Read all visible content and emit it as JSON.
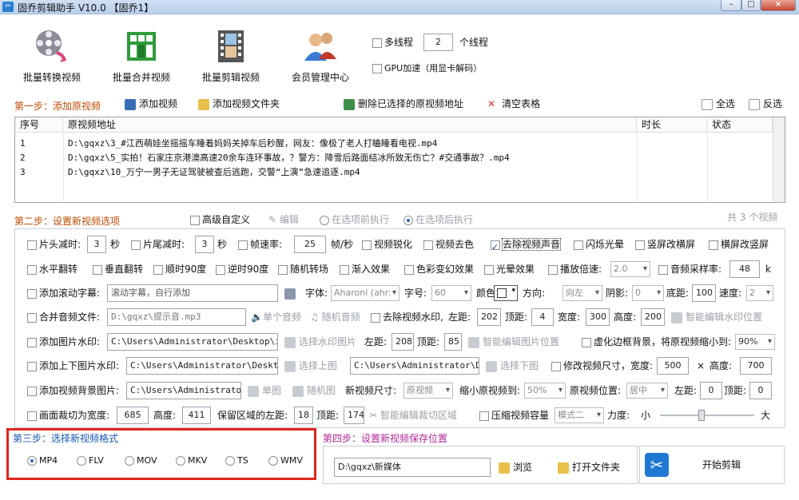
{
  "window": {
    "title": "固乔剪辑助手 V10.0 【固乔1】",
    "icon": "scissors-app-icon",
    "min": "–",
    "max": "□",
    "close": "×"
  },
  "toolbar": [
    {
      "label": "批量转换视频",
      "icon": "film-reel-icon"
    },
    {
      "label": "批量合并视频",
      "icon": "merge-blocks-icon"
    },
    {
      "label": "批量剪辑视频",
      "icon": "film-strip-icon"
    },
    {
      "label": "会员管理中心",
      "icon": "users-icon"
    }
  ],
  "multithread": {
    "label": "多线程",
    "value": "2",
    "unit": "个线程"
  },
  "gpu": {
    "label": "GPU加速（用显卡解码）"
  },
  "step1": {
    "title": "第一步：添加原视频",
    "add_video": "添加视频",
    "add_folder": "添加视频文件夹",
    "delete_selected": "删除已选择的原视频地址",
    "clear_table": "清空表格",
    "select_all": "全选",
    "invert": "反选"
  },
  "table": {
    "columns": [
      "序号",
      "原视频地址",
      "时长",
      "状态"
    ],
    "rows": [
      {
        "num": "1",
        "path": "D:\\gqxz\\3_#江西萌娃坐摇摇车睡着妈妈关掉车后秒醒，网友：像极了老人打瞌睡看电视.mp4",
        "dur": "",
        "status": ""
      },
      {
        "num": "2",
        "path": "D:\\gqxz\\5_实拍！石家庄京港澳高速20余车连环事故，？警方：降雪后路面结冰所致无伤亡？#交通事故？.mp4",
        "dur": "",
        "status": ""
      },
      {
        "num": "3",
        "path": "D:\\gqxz\\10_万宁一男子无证驾驶被查后逃跑，交警“上演”急速追逐.mp4",
        "dur": "",
        "status": ""
      }
    ]
  },
  "step2": {
    "title": "第二步：设置新视频选项",
    "advanced": "高级自定义",
    "edit": "编辑",
    "before": "在选项前执行",
    "after": "在选项后执行",
    "count": "共 3 个视频"
  },
  "opts": {
    "r1": {
      "head_cut": "片头减时:",
      "head_val": "3",
      "sec1": "秒",
      "tail_cut": "片尾减时:",
      "tail_val": "3",
      "sec2": "秒",
      "fps": "帧速率:",
      "fps_val": "25",
      "fps_unit": "帧/秒",
      "sharpen": "视频锐化",
      "decolor": "视频去色",
      "remove_audio": "去除视频声音",
      "flash": "闪烁光晕",
      "v2h": "竖屏改横屏",
      "h2v": "横屏改竖屏"
    },
    "r2": {
      "hflip": "水平翻转",
      "vflip": "垂直翻转",
      "cw90": "顺时90度",
      "ccw90": "逆时90度",
      "random_trans": "随机转场",
      "fade": "渐入效果",
      "color_fx": "色彩变幻效果",
      "halo": "光晕效果",
      "speed": "播放倍速:",
      "speed_val": "2.0",
      "sample": "音频采样率:",
      "sample_val": "48",
      "sample_unit": "k"
    },
    "r3": {
      "scroll": "添加滚动字幕:",
      "scroll_ph": "滚动字幕，自行添加",
      "font": "字体:",
      "font_val": "Aharoni (ahr:",
      "size": "字号:",
      "size_val": "60",
      "color": "颜色:",
      "dir": "方向:",
      "dir_val": "向左",
      "shadow": "阴影:",
      "shadow_val": "0",
      "bottom": "底距:",
      "bottom_val": "100",
      "speedl": "速度:",
      "speed_val": "2"
    },
    "r4": {
      "merge_audio": "合并音频文件:",
      "audio_path": "D:\\gqxz\\提示音.mp3",
      "single": "单个音频",
      "random": "随机音频",
      "remove_wm": "去除视频水印,",
      "left": "左距:",
      "left_val": "202",
      "top": "顶距:",
      "top_val": "4",
      "width": "宽度:",
      "width_val": "300",
      "height": "高度:",
      "height_val": "200",
      "smart_wm": "智能编辑水印位置"
    },
    "r5": {
      "img_wm": "添加图片水印:",
      "img_path": "C:\\Users\\Administrator\\Desktop\\img-q",
      "choose": "选择水印图片",
      "left": "左距:",
      "left_val": "208",
      "top": "顶距:",
      "top_val": "85",
      "smart": "智能编辑图片位置",
      "blur": "虚化边框背景，将原视频缩小到:",
      "blur_val": "90%"
    },
    "r6": {
      "tb_img": "添加上下图片水印:",
      "top_path": "C:\\Users\\Administrator\\Desktop\\i",
      "sel_top": "选择上图",
      "bottom_path": "C:\\Users\\Administrator\\Desk",
      "sel_bottom": "选择下图",
      "resize": "修改视频尺寸，宽度:",
      "w_val": "500",
      "x": "×",
      "h": "高度:",
      "h_val": "700"
    },
    "r7": {
      "bg_img": "添加视频背景图片:",
      "bg_path": "C:\\Users\\Administrator\\D",
      "single": "单图",
      "random": "随机图",
      "new_size": "新视频尺寸:",
      "new_size_val": "原视频",
      "shrink": "缩小原视频到:",
      "shrink_val": "50%",
      "pos": "原视频位置:",
      "pos_val": "居中",
      "left": "左距:",
      "left_val": "0",
      "top": "顶距:",
      "top_val": "0"
    },
    "r8": {
      "crop": "画面裁切为宽度:",
      "crop_w": "685",
      "h": "高度:",
      "crop_h": "411",
      "keep_left": "保留区域的左距:",
      "left_val": "18",
      "top": "顶距:",
      "top_val": "174",
      "smart_crop": "智能编辑裁切区域",
      "compress": "压缩视频容量",
      "mode_val": "模式二",
      "force": "力度:",
      "small": "小",
      "big": "大"
    }
  },
  "step3": {
    "title": "第三步：选择新视频格式",
    "formats": [
      "MP4",
      "FLV",
      "MOV",
      "MKV",
      "TS",
      "WMV"
    ],
    "selected": "MP4"
  },
  "step4": {
    "title": "第四步：设置新视频保存位置",
    "path": "D:\\gqxz\\新媒体",
    "browse": "浏览",
    "open_folder": "打开文件夹"
  },
  "start": {
    "label": "开始剪辑"
  },
  "colors": {
    "step": "#c04a00",
    "step3": "#1a57b3",
    "step4": "#b0279a",
    "highlight": "#e0261f"
  }
}
